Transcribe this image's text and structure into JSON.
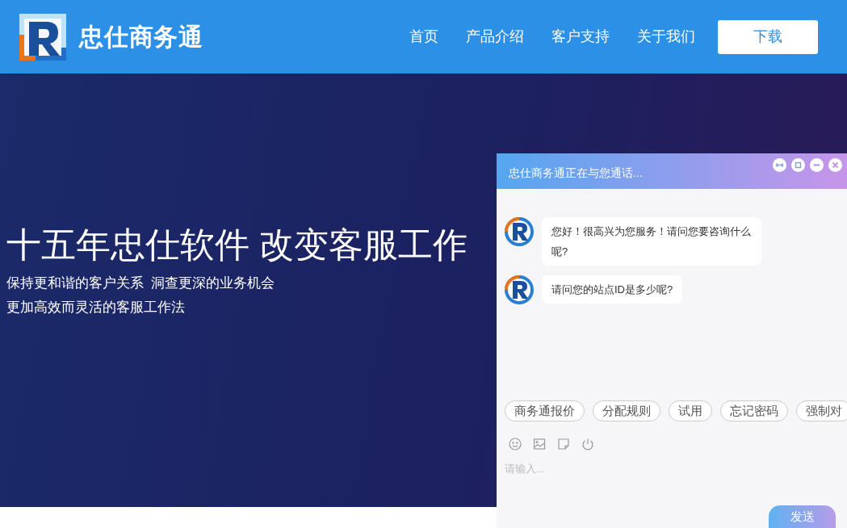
{
  "header": {
    "brand": "忠仕商务通",
    "nav": [
      {
        "label": "首页"
      },
      {
        "label": "产品介绍"
      },
      {
        "label": "客户支持"
      },
      {
        "label": "关于我们"
      }
    ],
    "download_button": "下载"
  },
  "hero": {
    "headline": "十五年忠仕软件 改变客服工作",
    "lines": [
      "保持更和谐的客户关系  洞查更深的业务机会",
      "更加高效而灵活的客服工作法"
    ]
  },
  "chat": {
    "title": "忠仕商务通正在与您通话...",
    "messages": [
      {
        "text": "您好！很高兴为您服务！请问您要咨询什么呢?"
      },
      {
        "text": "请问您的站点ID是多少呢?"
      }
    ],
    "quick_replies": [
      "商务通报价",
      "分配规则",
      "试用",
      "忘记密码",
      "强制对"
    ],
    "input": {
      "placeholder": "请输入..."
    },
    "send_button": "发送"
  }
}
